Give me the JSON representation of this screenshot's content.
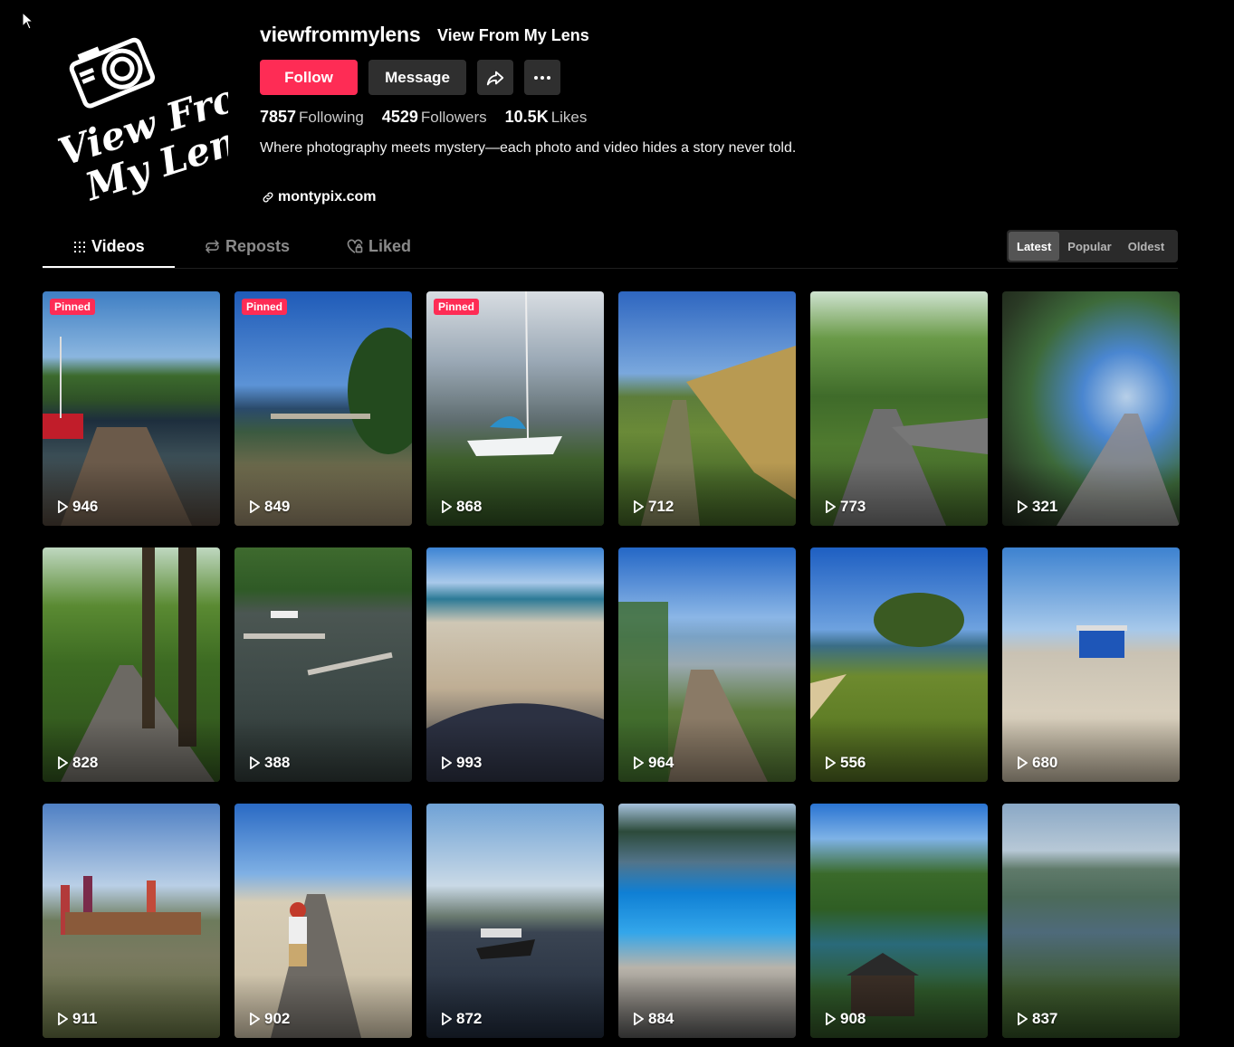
{
  "profile": {
    "username": "viewfrommylens",
    "display_name": "View From My Lens",
    "logo_text_line1": "View From",
    "logo_text_line2": "My Lens",
    "follow_label": "Follow",
    "message_label": "Message",
    "following_count": "7857",
    "following_label": "Following",
    "followers_count": "4529",
    "followers_label": "Followers",
    "likes_count": "10.5K",
    "likes_label": "Likes",
    "bio": "Where photography meets mystery—each photo and video hides a story never told.",
    "link": "montypix.com"
  },
  "tabs": [
    {
      "label": "Videos",
      "icon": "grid-icon",
      "active": true
    },
    {
      "label": "Reposts",
      "icon": "repost-icon",
      "active": false
    },
    {
      "label": "Liked",
      "icon": "heart-lock-icon",
      "active": false
    }
  ],
  "sort": [
    {
      "label": "Latest",
      "active": true
    },
    {
      "label": "Popular",
      "active": false
    },
    {
      "label": "Oldest",
      "active": false
    }
  ],
  "pinned_label": "Pinned",
  "videos": [
    {
      "views": "946",
      "pinned": true,
      "scene": "lake-pier-boat"
    },
    {
      "views": "849",
      "pinned": true,
      "scene": "harbor-sand"
    },
    {
      "views": "868",
      "pinned": true,
      "scene": "sailboat-reeds"
    },
    {
      "views": "712",
      "pinned": false,
      "scene": "corn-field-path"
    },
    {
      "views": "773",
      "pinned": false,
      "scene": "forest-path"
    },
    {
      "views": "321",
      "pinned": false,
      "scene": "motion-blur-road"
    },
    {
      "views": "828",
      "pinned": false,
      "scene": "tree-alley"
    },
    {
      "views": "388",
      "pinned": false,
      "scene": "marina-aerial"
    },
    {
      "views": "993",
      "pinned": false,
      "scene": "beach-waves"
    },
    {
      "views": "964",
      "pinned": false,
      "scene": "lake-jetty"
    },
    {
      "views": "556",
      "pinned": false,
      "scene": "cliff-sea"
    },
    {
      "views": "680",
      "pinned": false,
      "scene": "sandy-beach-hut"
    },
    {
      "views": "911",
      "pinned": false,
      "scene": "beach-flags"
    },
    {
      "views": "902",
      "pinned": false,
      "scene": "boardwalk-dog"
    },
    {
      "views": "872",
      "pinned": false,
      "scene": "motorboat-lake"
    },
    {
      "views": "884",
      "pinned": false,
      "scene": "pool-lake"
    },
    {
      "views": "908",
      "pinned": false,
      "scene": "lake-cabin-hills"
    },
    {
      "views": "837",
      "pinned": false,
      "scene": "lake-city-view"
    }
  ],
  "colors": {
    "accent": "#fe2c55",
    "background": "#000000",
    "button_dark": "#2f2f2f"
  }
}
